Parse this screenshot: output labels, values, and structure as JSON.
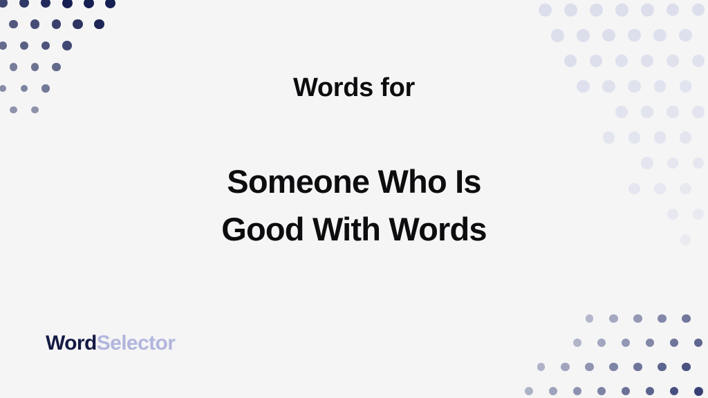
{
  "page": {
    "background_color": "#f5f5f6",
    "eyebrow": "Words for",
    "headline_lines": [
      "Someone Who Is",
      "Good With Words"
    ],
    "headline_text": "Someone Who Is Good With Words",
    "text_color": "#0d0d0f"
  },
  "logo": {
    "full_text": "WordSelector",
    "primary_text": "Word",
    "secondary_text": "Selector",
    "primary_color": "#141a44",
    "secondary_color": "#b2b6dd"
  },
  "decorations": {
    "top_left": {
      "name": "dot-grid-top-left",
      "darkest_color": "#161f52",
      "lightest_color": "#6b7191",
      "dot_size": 15,
      "spacing": 31,
      "columns": 7,
      "rows": 6
    },
    "top_right": {
      "name": "dot-grid-top-right",
      "color": "#dcdeec",
      "dot_size": 19,
      "spacing": 37,
      "columns": 7,
      "rows": 10
    },
    "bottom_right": {
      "name": "dot-grid-bottom-right",
      "darkest_color": "#373f72",
      "lightest_color": "#e6e7ee",
      "dot_size": 13,
      "spacing": 35,
      "columns": 9,
      "rows": 5
    }
  }
}
